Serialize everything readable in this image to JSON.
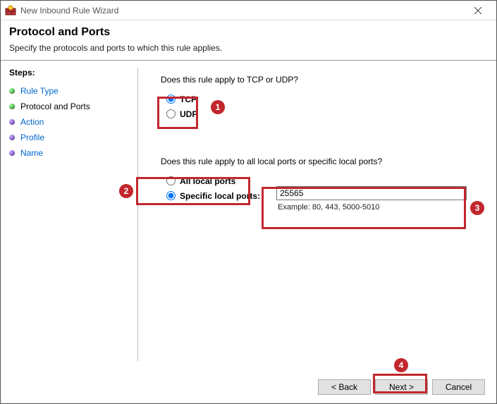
{
  "window": {
    "title": "New Inbound Rule Wizard"
  },
  "header": {
    "title": "Protocol and Ports",
    "subtitle": "Specify the protocols and ports to which this rule applies."
  },
  "steps": {
    "heading": "Steps:",
    "items": [
      {
        "label": "Rule Type",
        "state": "link"
      },
      {
        "label": "Protocol and Ports",
        "state": "current"
      },
      {
        "label": "Action",
        "state": "link"
      },
      {
        "label": "Profile",
        "state": "link"
      },
      {
        "label": "Name",
        "state": "link"
      }
    ]
  },
  "protocol": {
    "question": "Does this rule apply to TCP or UDP?",
    "tcp_label": "TCP",
    "udp_label": "UDP",
    "selected": "tcp"
  },
  "ports": {
    "question": "Does this rule apply to all local ports or specific local ports?",
    "all_label": "All local ports",
    "specific_label": "Specific local ports:",
    "selected": "specific",
    "value": "25565",
    "example": "Example: 80, 443, 5000-5010"
  },
  "buttons": {
    "back": "< Back",
    "next": "Next >",
    "cancel": "Cancel"
  },
  "annotations": {
    "b1": "1",
    "b2": "2",
    "b3": "3",
    "b4": "4"
  }
}
